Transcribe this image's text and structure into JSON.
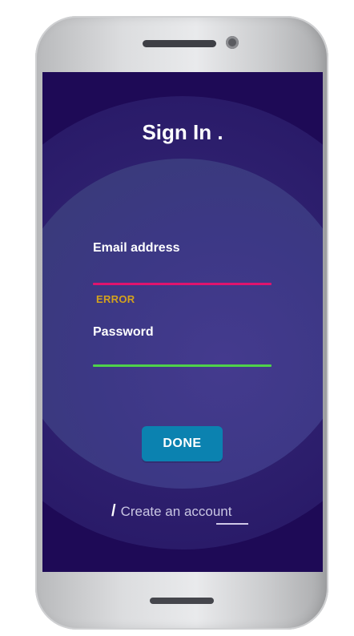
{
  "screen": {
    "title": "Sign In .",
    "email": {
      "label": "Email address",
      "value": "",
      "error_text": "ERROR",
      "underline_color": "#e0146e"
    },
    "password": {
      "label": "Password",
      "value": "",
      "underline_color": "#4fd24a"
    },
    "done_label": "DONE",
    "create_account": {
      "slash": "/",
      "label": "Create an account"
    }
  },
  "colors": {
    "background": "#1e0a56",
    "button": "#0b82b0",
    "error": "#d4a21c"
  }
}
